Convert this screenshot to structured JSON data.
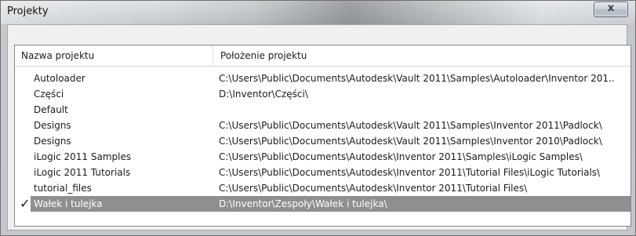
{
  "window": {
    "title": "Projekty",
    "close_label": "x"
  },
  "columns": {
    "name": "Nazwa projektu",
    "location": "Położenie projektu"
  },
  "rows": [
    {
      "name": "Autoloader",
      "location": "C:\\Users\\Public\\Documents\\Autodesk\\Vault 2011\\Samples\\Autoloader\\Inventor 201...",
      "check": "",
      "selected": false
    },
    {
      "name": "Części",
      "location": "D:\\Inventor\\Części\\",
      "check": "",
      "selected": false
    },
    {
      "name": "Default",
      "location": "",
      "check": "",
      "selected": false
    },
    {
      "name": "Designs",
      "location": "C:\\Users\\Public\\Documents\\Autodesk\\Vault 2011\\Samples\\Inventor 2011\\Padlock\\",
      "check": "",
      "selected": false
    },
    {
      "name": "Designs",
      "location": "C:\\Users\\Public\\Documents\\Autodesk\\Vault 2011\\Samples\\Inventor 2010\\Padlock\\",
      "check": "",
      "selected": false
    },
    {
      "name": "iLogic 2011 Samples",
      "location": "C:\\Users\\Public\\Documents\\Autodesk\\Inventor 2011\\Samples\\iLogic Samples\\",
      "check": "",
      "selected": false
    },
    {
      "name": "iLogic 2011 Tutorials",
      "location": "C:\\Users\\Public\\Documents\\Autodesk\\Inventor 2011\\Tutorial Files\\iLogic Tutorials\\",
      "check": "",
      "selected": false
    },
    {
      "name": "tutorial_files",
      "location": "C:\\Users\\Public\\Documents\\Autodesk\\Inventor 2011\\Tutorial Files\\",
      "check": "",
      "selected": false
    },
    {
      "name": "Wałek i tulejka",
      "location": "D:\\Inventor\\Zespoły\\Wałek i tulejka\\",
      "check": "✓",
      "selected": true
    }
  ]
}
